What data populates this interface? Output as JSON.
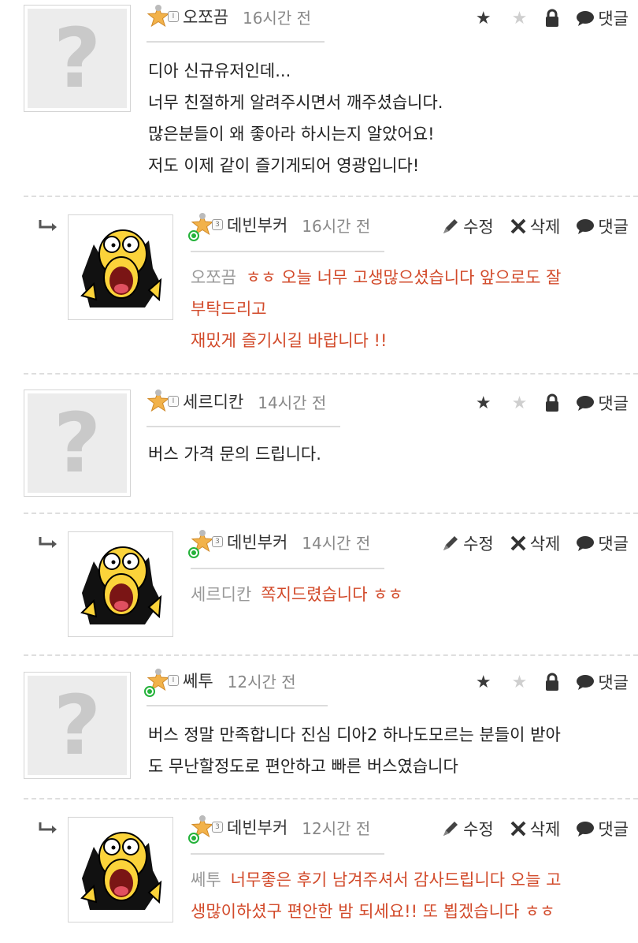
{
  "comments": [
    {
      "nick": "오쪼끔",
      "time": "16시간 전",
      "level": "I",
      "lines": [
        "디아 신규유저인데...",
        "너무 친절하게 알려주시면서 깨주셨습니다.",
        "많은분들이 왜 좋아라 하시는지 알았어요!",
        "저도 이제 같이 즐기게되어 영광입니다!"
      ],
      "reply_label": "댓글",
      "reply": {
        "nick": "데빈부커",
        "time": "16시간 전",
        "level": "3",
        "mention": "오쪼끔",
        "lines": [
          "ㅎㅎ 오늘 너무 고생많으셨습니다 앞으로도 잘",
          "부탁드리고",
          "재밌게 즐기시길 바랍니다 !!"
        ],
        "edit_label": "수정",
        "delete_label": "삭제",
        "reply_label": "댓글"
      }
    },
    {
      "nick": "세르디칸",
      "time": "14시간 전",
      "level": "I",
      "lines": [
        "버스 가격 문의 드립니다."
      ],
      "reply_label": "댓글",
      "reply": {
        "nick": "데빈부커",
        "time": "14시간 전",
        "level": "3",
        "mention": "세르디칸",
        "lines": [
          "쪽지드렸습니다 ㅎㅎ"
        ],
        "edit_label": "수정",
        "delete_label": "삭제",
        "reply_label": "댓글"
      }
    },
    {
      "nick": "쎄투",
      "time": "12시간 전",
      "level": "I",
      "lines": [
        "버스 정말 만족합니다 진심 디아2 하나도모르는 분들이 받아",
        "도 무난할정도로 편안하고 빠른 버스였습니다"
      ],
      "reply_label": "댓글",
      "reply": {
        "nick": "데빈부커",
        "time": "12시간 전",
        "level": "3",
        "mention": "쎄투",
        "lines": [
          "너무좋은 후기 남겨주셔서 감사드립니다 오늘 고",
          "생많이하셨구 편안한 밤 되세요!! 또 뵙겠습니다 ㅎㅎ"
        ],
        "edit_label": "수정",
        "delete_label": "삭제",
        "reply_label": "댓글"
      }
    }
  ],
  "colors": {
    "reply_text": "#d24a2a",
    "online": "#24b23a",
    "mention": "#999999"
  },
  "icons": [
    "star-icon",
    "lock-icon",
    "speech-bubble-icon",
    "pencil-icon",
    "x-icon",
    "reply-arrow-icon",
    "level-badge-icon",
    "question-mark-avatar",
    "homer-avatar"
  ]
}
